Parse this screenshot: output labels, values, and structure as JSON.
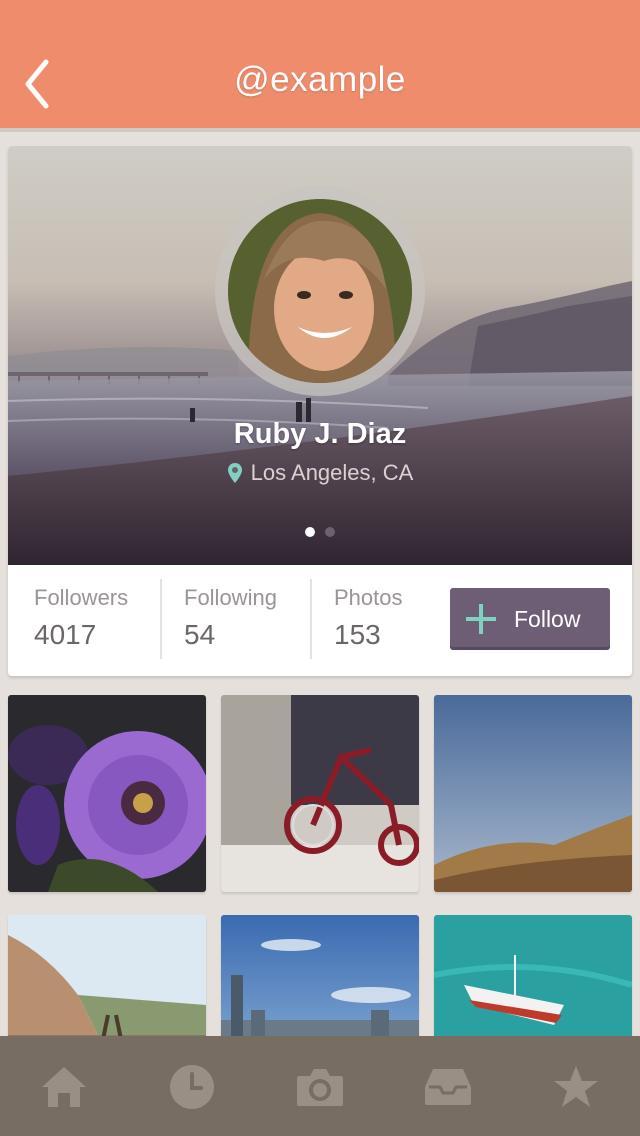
{
  "header": {
    "title": "@example",
    "back_icon": "chevron-left-icon",
    "background": "#ef8c6c"
  },
  "profile": {
    "name": "Ruby J. Diaz",
    "location": "Los Angeles, CA",
    "location_icon": "map-pin-icon",
    "pin_color": "#7fd1c0",
    "carousel": {
      "pages": 2,
      "active_page": 1
    }
  },
  "stats": [
    {
      "label": "Followers",
      "value": "4017"
    },
    {
      "label": "Following",
      "value": "54"
    },
    {
      "label": "Photos",
      "value": "153"
    }
  ],
  "follow_button": {
    "label": "Follow",
    "icon": "plus-icon",
    "color": "#6d5d75",
    "icon_color": "#7fd1c0"
  },
  "photos": [
    {
      "subject": "purple flower"
    },
    {
      "subject": "red tricycle"
    },
    {
      "subject": "desert hills"
    },
    {
      "subject": "coastal railway"
    },
    {
      "subject": "city skyline"
    },
    {
      "subject": "boat on sea"
    }
  ],
  "tabbar": {
    "background": "#786d62",
    "items": [
      {
        "icon": "home-icon"
      },
      {
        "icon": "clock-icon"
      },
      {
        "icon": "camera-icon"
      },
      {
        "icon": "inbox-icon"
      },
      {
        "icon": "star-icon"
      }
    ]
  }
}
